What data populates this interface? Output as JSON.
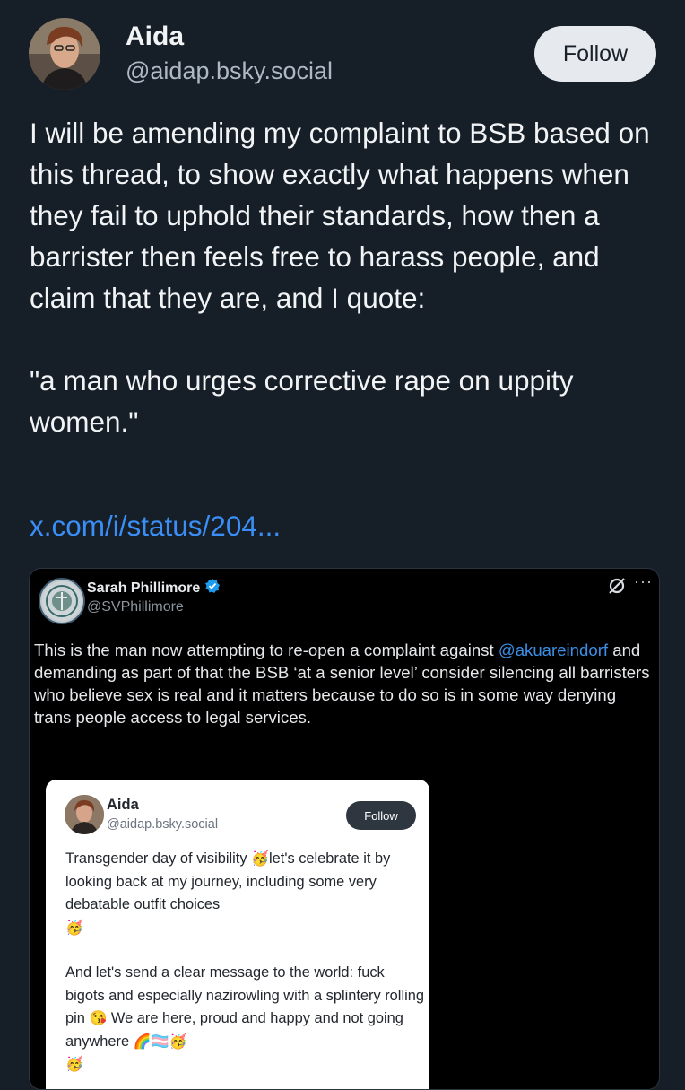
{
  "post": {
    "author_name": "Aida",
    "author_handle": "@aidap.bsky.social",
    "follow_label": "Follow",
    "text": "I will be amending my complaint to BSB based on this thread, to show exactly what happens when they fail to uphold their standards, how then a barrister then feels free to harass people, and claim that they are, and I quote:\n\n\"a man who urges corrective rape on uppity women.\"",
    "link_text": "x.com/i/status/204..."
  },
  "embed": {
    "author_name": "Sarah Phillimore",
    "author_handle": "@SVPhillimore",
    "more_label": "···",
    "text_before": "This is the man now attempting to re-open a complaint against ",
    "mention": "@akuareindorf",
    "text_after": " and demanding as part of that the BSB ‘at a senior level’ consider silencing all barristers who believe sex is real and it matters because to do so is in some way denying trans people access to legal services.",
    "inner_post": {
      "author_name": "Aida",
      "author_handle": "@aidap.bsky.social",
      "follow_label": "Follow",
      "p1_a": "Transgender day of visibility ",
      "emoji_party": "🥳",
      "p1_b": "let's celebrate it by looking back at my journey, including some very debatable outfit choices",
      "p2_a": "And let's send a clear message to the world: fuck bigots and especially nazirowling with a splintery rolling pin ",
      "emoji_kiss": "😘",
      "p2_b": " We are here, proud and happy and not going anywhere ",
      "emoji_flags": "🌈🏳️‍⚧️"
    }
  },
  "colors": {
    "background": "#161e27",
    "link": "#3a8ef6",
    "mention": "#3b8fe6",
    "verified": "#1d9bf0"
  },
  "icons": {
    "author_avatar": "profile-photo",
    "embed_avatar": "seal-logo",
    "verified": "verified-badge-icon",
    "grok": "slash-circle-icon",
    "more": "more-icon"
  }
}
